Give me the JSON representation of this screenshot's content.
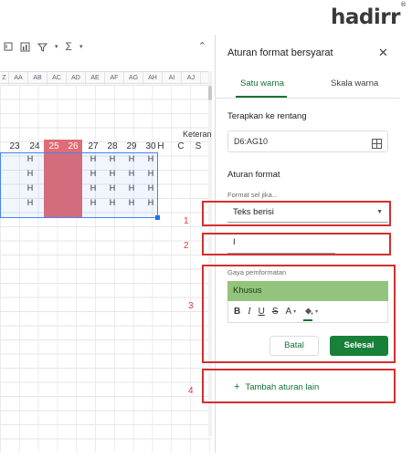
{
  "logo": {
    "text": "hadirr",
    "mark": "®"
  },
  "sheet": {
    "columns": [
      "Z",
      "AA",
      "AB",
      "AC",
      "AD",
      "AE",
      "AF",
      "AG",
      "AH",
      "AI",
      "AJ"
    ],
    "days": [
      "23",
      "24",
      "25",
      "26",
      "27",
      "28",
      "29",
      "30",
      "H",
      "C",
      "S"
    ],
    "keterangan": "Keteran",
    "cell_value": "H",
    "highlight_color": "#e06c75"
  },
  "panel": {
    "title": "Aturan format bersyarat",
    "tabs": [
      {
        "label": "Satu warna",
        "active": true
      },
      {
        "label": "Skala warna",
        "active": false
      }
    ],
    "apply_range_label": "Terapkan ke rentang",
    "range_value": "D6:AG10",
    "rules_label": "Aturan format",
    "condition_label": "Format sel jika...",
    "condition_value": "Teks berisi",
    "value_input": "I",
    "style_label": "Gaya pemformatan",
    "style_value": "Khusus",
    "style_color": "#93c47d",
    "format_buttons": [
      "B",
      "I",
      "U",
      "S",
      "A"
    ],
    "cancel_label": "Batal",
    "done_label": "Selesai",
    "add_rule_label": "Tambah aturan lain"
  },
  "annotations": [
    "1",
    "2",
    "3",
    "4"
  ],
  "accent_color": "#137333"
}
